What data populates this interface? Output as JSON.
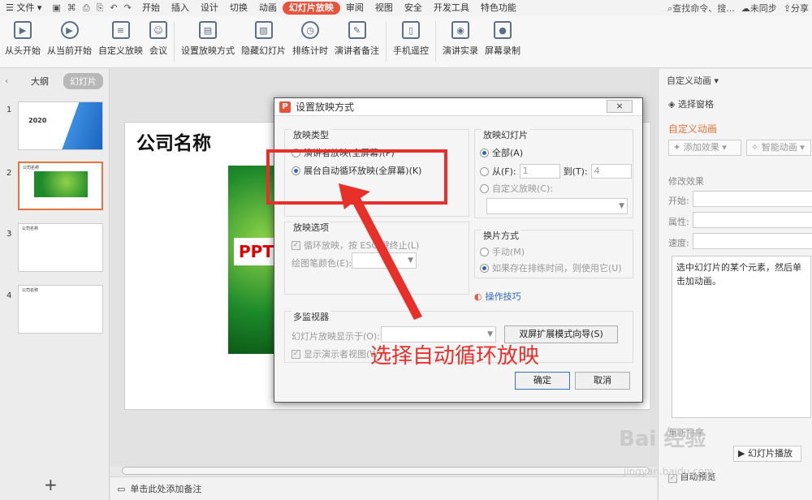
{
  "menubar": {
    "file": "文件",
    "tabs": [
      "开始",
      "插入",
      "设计",
      "切换",
      "动画",
      "幻灯片放映",
      "审阅",
      "视图",
      "安全",
      "开发工具",
      "特色功能"
    ],
    "active_tab": "幻灯片放映",
    "search": "查找命令、搜...",
    "sync": "未同步",
    "share": "分享"
  },
  "ribbon": {
    "buttons": [
      "从头开始",
      "从当前开始",
      "自定义放映",
      "会议",
      "设置放映方式",
      "隐藏幻灯片",
      "排练计时",
      "演讲者备注",
      "手机遥控",
      "演讲实录",
      "屏幕录制"
    ]
  },
  "leftpanel": {
    "tab_outline": "大纲",
    "tab_slides": "幻灯片",
    "slides": [
      {
        "num": "1",
        "text": "2020"
      },
      {
        "num": "2",
        "text": "公司名称"
      },
      {
        "num": "3",
        "text": "公司名称"
      },
      {
        "num": "4",
        "text": "公司名称"
      }
    ],
    "add": "+"
  },
  "slide": {
    "title": "公司名称",
    "ppt_text": "PPT"
  },
  "notes": {
    "placeholder": "单击此处添加备注"
  },
  "rightpanel": {
    "header": "自定义动画",
    "select_pane": "选择窗格",
    "section_title": "自定义动画",
    "add_effect": "添加效果",
    "smart_anim": "智能动画",
    "modify": "修改效果",
    "start": "开始:",
    "prop": "属性:",
    "speed": "速度:",
    "hint": "选中幻灯片的某个元素，然后单击加动画。",
    "reorder": "重新排序",
    "play": "幻灯片播放",
    "autopreview": "自动预览"
  },
  "dialog": {
    "title": "设置放映方式",
    "close": "×",
    "type_group": "放映类型",
    "type_speaker": "演讲者放映(全屏幕)(P)",
    "type_kiosk": "展台自动循环放映(全屏幕)(K)",
    "slides_group": "放映幻灯片",
    "all": "全部(A)",
    "from": "从(F):",
    "from_val": "1",
    "to": "到(T):",
    "to_val": "4",
    "custom": "自定义放映(C):",
    "options_group": "放映选项",
    "loop": "循环放映，按 ESC 键终止(L)",
    "pen_color": "绘图笔颜色(E):",
    "advance_group": "换片方式",
    "manual": "手动(M)",
    "timing": "如果存在排练时间，则使用它(U)",
    "tips": "操作技巧",
    "monitor_group": "多监视器",
    "display_on": "幻灯片放映显示于(O):",
    "dual_btn": "双屏扩展模式向导(S)",
    "presenter_view": "显示演示者视图(W)",
    "ok": "确定",
    "cancel": "取消"
  },
  "annotation": {
    "text": "选择自动循环放映"
  },
  "watermark": {
    "text": "Bai 经验",
    "sub": "jingyan.baidu.com"
  },
  "colors": {
    "accent": "#e8533b",
    "annotation": "#e8302b",
    "radio": "#2a64c5"
  }
}
